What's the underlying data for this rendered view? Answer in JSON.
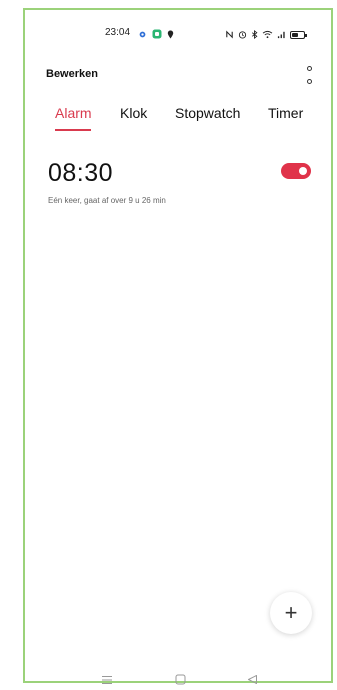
{
  "status_bar": {
    "time": "23:04",
    "icons": [
      "gear-icon",
      "app-icon",
      "location-icon",
      "nfc-icon",
      "alarm-icon",
      "bluetooth-icon",
      "wifi-icon",
      "signal-icon",
      "battery-icon"
    ]
  },
  "header": {
    "edit_label": "Bewerken",
    "menu_icon": "more-vertical-icon"
  },
  "tabs": [
    {
      "label": "Alarm",
      "active": true
    },
    {
      "label": "Klok",
      "active": false
    },
    {
      "label": "Stopwatch",
      "active": false
    },
    {
      "label": "Timer",
      "active": false
    }
  ],
  "alarms": [
    {
      "time": "08:30",
      "description": "Eén keer, gaat af over 9 u 26 min",
      "enabled": true
    }
  ],
  "fab": {
    "label": "+",
    "icon": "add-icon"
  },
  "nav_bar": {
    "items": [
      "menu-icon",
      "home-icon",
      "back-icon"
    ]
  },
  "colors": {
    "accent": "#d93a4e",
    "toggle_on": "#e0334a",
    "frame_border": "#9bd27a"
  }
}
